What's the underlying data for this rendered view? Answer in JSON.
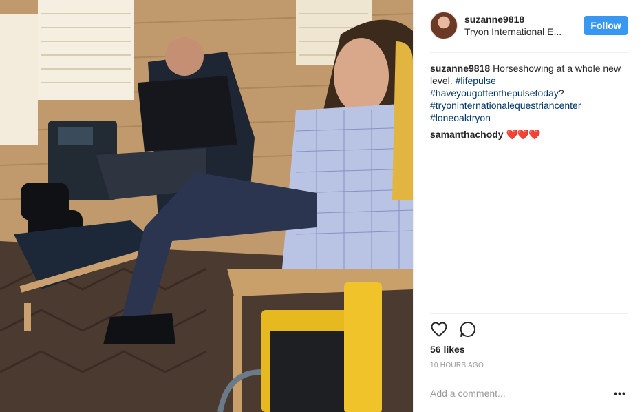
{
  "post": {
    "author": {
      "username": "suzanne9818",
      "location": "Tryon International E..."
    },
    "follow_label": "Follow",
    "caption": {
      "username": "suzanne9818",
      "text": "Horseshowing at a whole new level.",
      "hashtags": [
        "#lifepulse",
        "#haveyougottenthepulsetoday",
        "#tryoninternationalequestriancenter",
        "#loneoaktryon"
      ],
      "question_mark": "?"
    },
    "comments": [
      {
        "username": "samanthachody",
        "text": "❤️❤️❤️"
      }
    ],
    "likes": "56 likes",
    "timestamp": "10 HOURS AGO",
    "add_comment_placeholder": "Add a comment...",
    "more_label": "•••"
  },
  "icons": {
    "like": "heart-outline-icon",
    "comment": "speech-bubble-icon",
    "more": "ellipsis-icon"
  },
  "colors": {
    "follow_button": "#3897f0",
    "hashtag": "#003569",
    "muted": "#999999"
  }
}
